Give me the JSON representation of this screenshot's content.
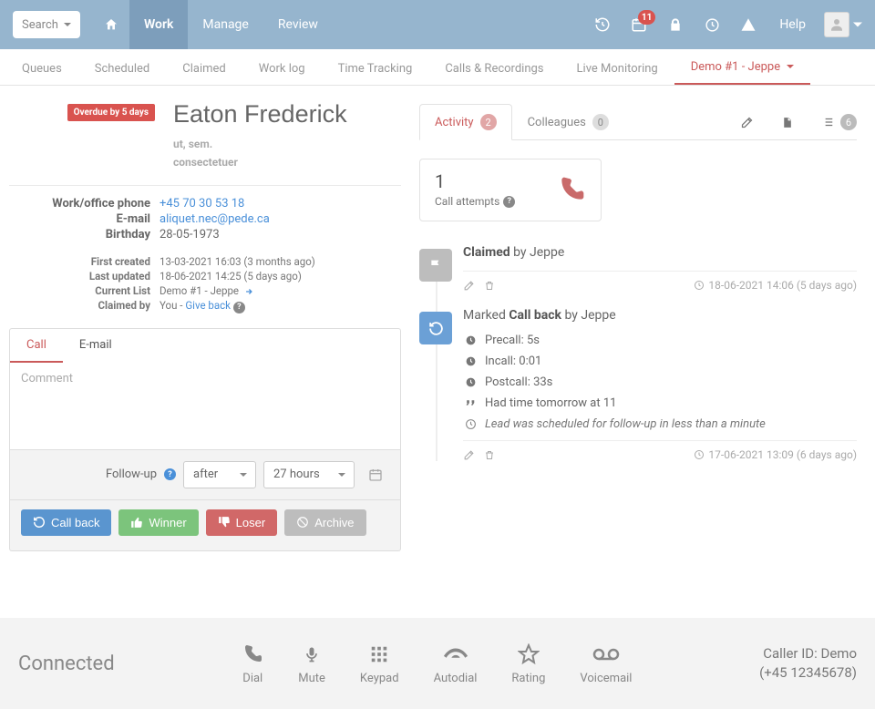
{
  "topbar": {
    "search_label": "Search",
    "nav": [
      "Work",
      "Manage",
      "Review"
    ],
    "help_label": "Help",
    "badge_count": "11"
  },
  "subtabs": [
    "Queues",
    "Scheduled",
    "Claimed",
    "Work log",
    "Time Tracking",
    "Calls & Recordings",
    "Live Monitoring",
    "Demo #1 - Jeppe"
  ],
  "contact": {
    "overdue": "Overdue by 5 days",
    "name": "Eaton Frederick",
    "line1": "ut, sem.",
    "line2": "consectetuer",
    "fields": {
      "phone_label": "Work/office phone",
      "phone_value": "+45 70 30 53 18",
      "email_label": "E-mail",
      "email_value": "aliquet.nec@pede.ca",
      "bday_label": "Birthday",
      "bday_value": "28-05-1973"
    },
    "meta": {
      "created_label": "First created",
      "created_value": "13-03-2021 16:03 (3 months ago)",
      "updated_label": "Last updated",
      "updated_value": "18-06-2021 14:25 (5 days ago)",
      "list_label": "Current List",
      "list_value": "Demo #1 - Jeppe",
      "claimed_label": "Claimed by",
      "claimed_prefix": "You - ",
      "claimed_link": "Give back"
    }
  },
  "ce": {
    "tab_call": "Call",
    "tab_email": "E-mail",
    "comment_placeholder": "Comment",
    "followup_label": "Follow-up",
    "followup_mode": "after",
    "followup_val": "27 hours"
  },
  "actions": {
    "callback": "Call back",
    "winner": "Winner",
    "loser": "Loser",
    "archive": "Archive"
  },
  "rc": {
    "activity": "Activity",
    "activity_n": "2",
    "colleagues": "Colleagues",
    "colleagues_n": "0",
    "list_n": "6"
  },
  "attempts": {
    "n": "1",
    "label": "Call attempts"
  },
  "timeline": {
    "claimed_title_b": "Claimed",
    "claimed_title_rest": " by Jeppe",
    "claimed_ts": "18-06-2021 14:06 (5 days ago)",
    "cb_prefix": "Marked ",
    "cb_bold": "Call back",
    "cb_suffix": " by Jeppe",
    "precall": "Precall: 5s",
    "incall": "Incall: 0:01",
    "postcall": "Postcall: 33s",
    "quote": "Had time tomorrow at 11",
    "sched_note": "Lead was scheduled for follow-up in less than a minute",
    "cb_ts": "17-06-2021 13:09 (6 days ago)"
  },
  "footer": {
    "status": "Connected",
    "dial": "Dial",
    "mute": "Mute",
    "keypad": "Keypad",
    "autodial": "Autodial",
    "rating": "Rating",
    "voicemail": "Voicemail",
    "caller_line1": "Caller ID: Demo",
    "caller_line2": "(+45 12345678)"
  }
}
